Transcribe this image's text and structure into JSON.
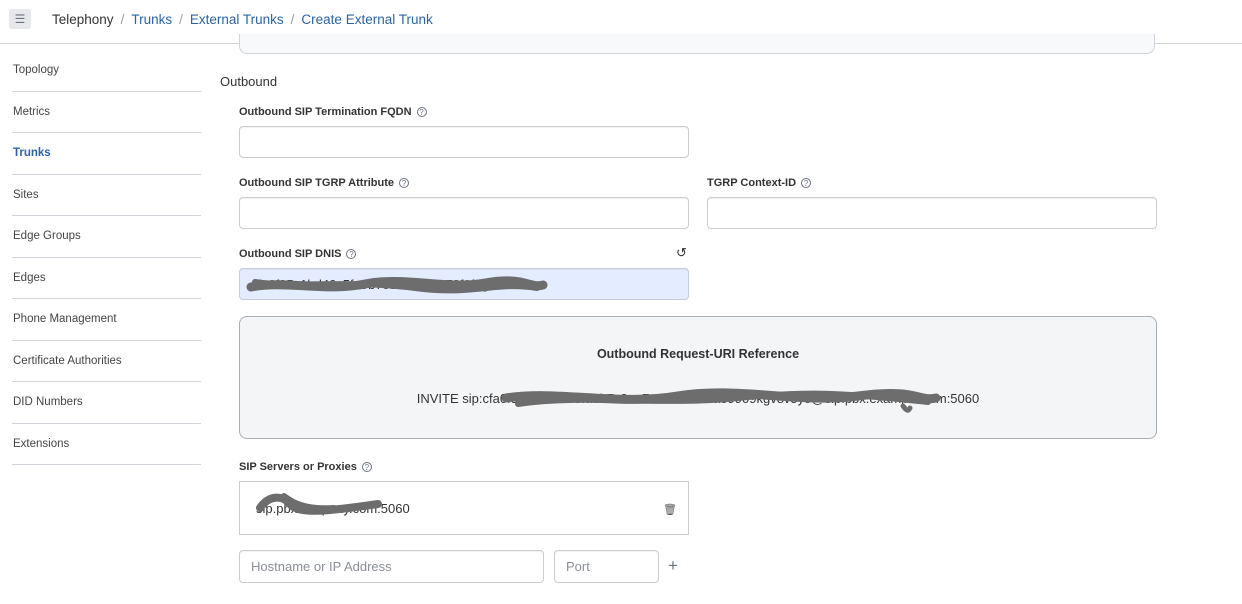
{
  "header": {
    "menu_icon": "menu-icon",
    "breadcrumbs": [
      "Telephony",
      "Trunks",
      "External Trunks",
      "Create External Trunk"
    ]
  },
  "sidebar": {
    "active": "Trunks",
    "items": [
      "Topology",
      "Metrics",
      "Trunks",
      "Sites",
      "Edge Groups",
      "Edges",
      "Phone Management",
      "Certificate Authorities",
      "DID Numbers",
      "Extensions"
    ]
  },
  "form": {
    "section_title": "Outbound",
    "fqdn": {
      "label": "Outbound SIP Termination FQDN",
      "value": ""
    },
    "tgrp": {
      "label": "Outbound SIP TGRP Attribute",
      "value": ""
    },
    "context": {
      "label": "TGRP Context-ID",
      "value": ""
    },
    "dnis": {
      "label": "Outbound SIP DNIS",
      "value": "cfa0f35c1bd40c5fa9b7c3aa7cc2a73f9fpgcnezu",
      "reset_icon": "reset-icon"
    },
    "reference": {
      "title": "Outbound Request-URI Reference",
      "value": "INVITE sip:cfa0f35c1bd40c5fa9b7c3aa7cc2a73ee0a89909kgv8v5yo@sip.pbx.example.com:5060"
    },
    "servers": {
      "label": "SIP Servers or Proxies",
      "items": [
        {
          "value": "sip.pbxcompany.com:5060"
        }
      ],
      "hostname_placeholder": "Hostname or IP Address",
      "port_placeholder": "Port",
      "add_icon": "plus-icon",
      "delete_icon": "trash-icon"
    }
  }
}
